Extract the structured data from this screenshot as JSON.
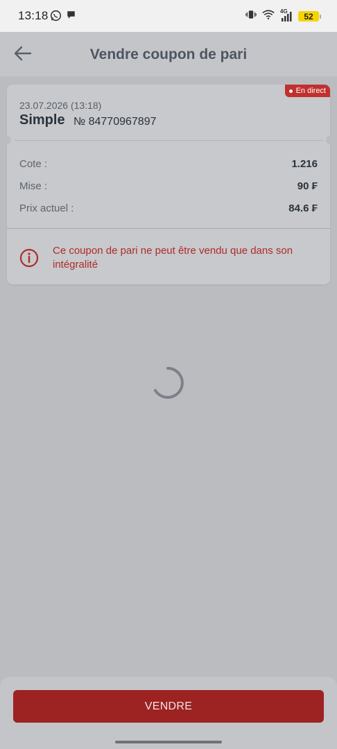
{
  "status_bar": {
    "time": "13:18",
    "left_icons": [
      "whatsapp-icon",
      "chat-bubble-icon"
    ],
    "right_icons": [
      "vibrate-icon",
      "wifi-icon",
      "signal-4g-icon"
    ],
    "network_label": "4G",
    "battery_level": "52",
    "battery_color": "#f5d400"
  },
  "header": {
    "title": "Vendre coupon de pari",
    "back_icon": "arrow-left-icon"
  },
  "bet_card": {
    "live_badge": "En direct",
    "date": "23.07.2026 (13:18)",
    "bet_type": "Simple",
    "bet_number": "№ 84770967897",
    "details": {
      "cote": {
        "label": "Cote :",
        "value": "1.216"
      },
      "mise": {
        "label": "Mise :",
        "value": "90 ₣"
      },
      "prix": {
        "label": "Prix actuel :",
        "value": "84.6 ₣"
      }
    },
    "warning": {
      "icon": "info-circle-icon",
      "text": "Ce coupon de pari ne peut être vendu que dans son intégralité"
    }
  },
  "loading": {
    "icon": "spinner-icon"
  },
  "footer": {
    "sell_button_label": "VENDRE"
  },
  "colors": {
    "accent": "#9d2222",
    "badge": "#c12f2f",
    "warning_text": "#b02a2a",
    "overlay_bg": "#babcbf"
  }
}
